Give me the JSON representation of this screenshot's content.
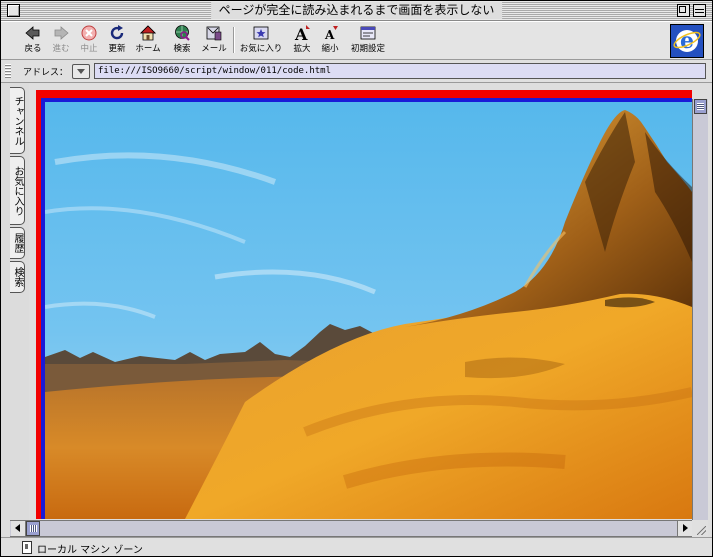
{
  "window": {
    "title": "ページが完全に読み込まれるまで画面を表示しない"
  },
  "toolbar": {
    "buttons": [
      {
        "label": "戻る",
        "icon": "back-arrow-icon",
        "enabled": true
      },
      {
        "label": "進む",
        "icon": "forward-arrow-icon",
        "enabled": false
      },
      {
        "label": "中止",
        "icon": "stop-icon",
        "enabled": false
      },
      {
        "label": "更新",
        "icon": "refresh-icon",
        "enabled": true
      },
      {
        "label": "ホーム",
        "icon": "home-icon",
        "enabled": true
      },
      {
        "label": "検索",
        "icon": "search-globe-icon",
        "enabled": true
      },
      {
        "label": "メール",
        "icon": "mail-icon",
        "enabled": true
      },
      {
        "label": "お気に入り",
        "icon": "favorites-icon",
        "enabled": true
      },
      {
        "label": "拡大",
        "icon": "text-larger-icon",
        "enabled": true
      },
      {
        "label": "縮小",
        "icon": "text-smaller-icon",
        "enabled": true
      },
      {
        "label": "初期設定",
        "icon": "preferences-icon",
        "enabled": true
      }
    ]
  },
  "address": {
    "label": "アドレス：",
    "value": "file:///ISO9660/script/window/011/code.html"
  },
  "sidebar_tabs": [
    "チャンネル",
    "お気に入り",
    "履歴",
    "検索"
  ],
  "status": {
    "zone": "ローカル マシン ゾーン"
  },
  "colors": {
    "frame_outer": "#f20000",
    "frame_inner": "#1a1ad8",
    "address_field_bg": "#dcdcf4",
    "scroll_thumb": "#9aa0d0"
  }
}
